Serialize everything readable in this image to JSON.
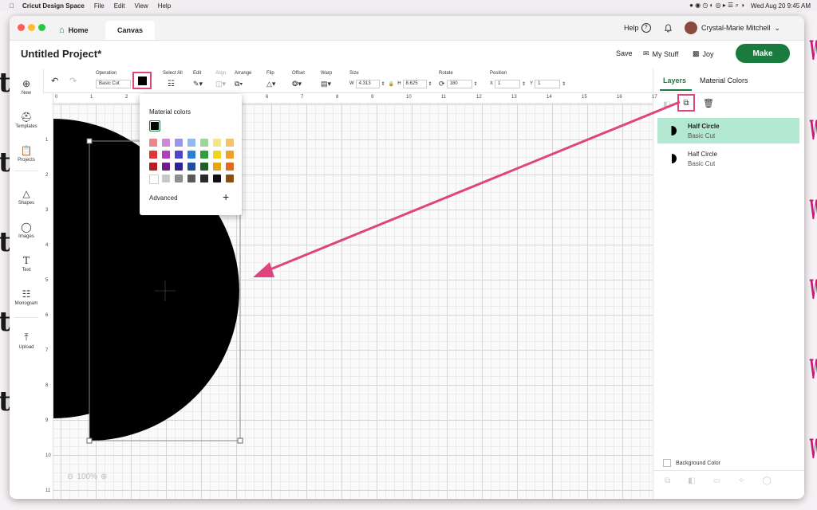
{
  "menubar": {
    "app_name": "Cricut Design Space",
    "items": [
      "File",
      "Edit",
      "View",
      "Help"
    ],
    "clock": "Wed Aug 20  9:45 AM"
  },
  "window": {
    "tabs": [
      {
        "label": "Home"
      },
      {
        "label": "Canvas"
      }
    ],
    "help_label": "Help",
    "user_name": "Crystal-Marie Mitchell"
  },
  "header": {
    "project_title": "Untitled Project*",
    "save_label": "Save",
    "mystuff_label": "My Stuff",
    "machine_label": "Joy",
    "make_label": "Make"
  },
  "toolbar": {
    "operation_label": "Operation",
    "operation_value": "Basic Cut",
    "select_all_label": "Select All",
    "edit_label": "Edit",
    "align_label": "Align",
    "arrange_label": "Arrange",
    "flip_label": "Flip",
    "offset_label": "Offset",
    "warp_label": "Warp",
    "size_label": "Size",
    "width_label": "W",
    "width_value": "4.313",
    "height_label": "H",
    "height_value": "8.625",
    "rotate_label": "Rotate",
    "rotate_value": "180",
    "position_label": "Position",
    "x_label": "X",
    "x_value": "1",
    "y_label": "Y",
    "y_value": "1",
    "current_color": "#000000"
  },
  "sidebar": {
    "items": [
      {
        "label": "New",
        "icon": "plus-circle-icon"
      },
      {
        "label": "Templates",
        "icon": "shirt-icon"
      },
      {
        "label": "Projects",
        "icon": "clipboard-icon"
      },
      {
        "label": "Shapes",
        "icon": "shapes-icon"
      },
      {
        "label": "Images",
        "icon": "lightbulb-icon"
      },
      {
        "label": "Text",
        "icon": "text-t-icon"
      },
      {
        "label": "Monogram",
        "icon": "monogram-icon"
      },
      {
        "label": "Upload",
        "icon": "upload-icon"
      }
    ]
  },
  "ruler": {
    "top": [
      "0",
      "1",
      "2",
      "3",
      "4",
      "5",
      "6",
      "7",
      "8",
      "9",
      "10",
      "11",
      "12",
      "13",
      "14",
      "15",
      "16",
      "17"
    ],
    "left": [
      "1",
      "2",
      "3",
      "4",
      "5",
      "6",
      "7",
      "8",
      "9",
      "10",
      "11"
    ]
  },
  "canvas": {
    "zoom": "100%"
  },
  "color_popup": {
    "title": "Material colors",
    "advanced_label": "Advanced",
    "selected": "#000000",
    "swatches": [
      [
        "#e8888a",
        "#c98bd4",
        "#9a95e8",
        "#8fb9ef",
        "#9dd59a",
        "#f3e68a",
        "#f4c26e"
      ],
      [
        "#e0363a",
        "#b13fb8",
        "#5145c8",
        "#2a7fd8",
        "#2f9e3a",
        "#f1d61f",
        "#f0a02a"
      ],
      [
        "#b41d22",
        "#6f1e8a",
        "#2a2490",
        "#1c4f9c",
        "#1f5f26",
        "#e2a513",
        "#e06a1e"
      ],
      [
        "#ffffff",
        "#c9c9c9",
        "#8f8f8f",
        "#5a5a5a",
        "#2a2a2a",
        "#111111",
        "#8a4e12"
      ]
    ]
  },
  "layers_panel": {
    "tab_layers": "Layers",
    "tab_material": "Material Colors",
    "layers": [
      {
        "name": "Half Circle",
        "op": "Basic Cut",
        "selected": true
      },
      {
        "name": "Half Circle",
        "op": "Basic Cut",
        "selected": false
      }
    ],
    "background_color_label": "Background Color"
  },
  "colors": {
    "accent_pink": "#e0447f",
    "make_green": "#1b7a3e",
    "layer_selected": "#b3e8d3"
  }
}
